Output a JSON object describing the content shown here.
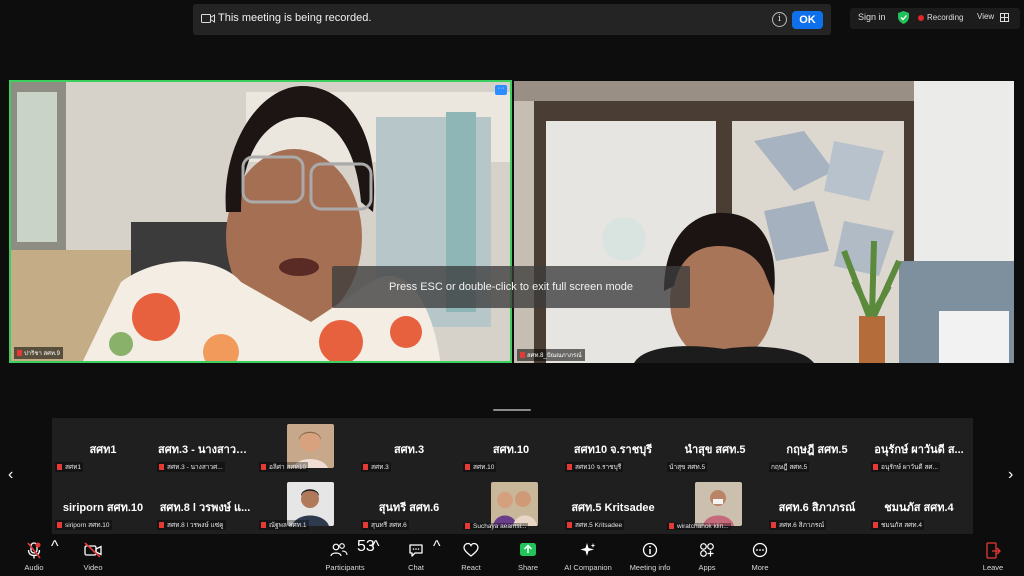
{
  "banner": {
    "message": "This meeting is being recorded.",
    "ok_label": "OK",
    "info_glyph": "i"
  },
  "top_right": {
    "sign_in": "Sign in",
    "recording": "Recording",
    "view": "View"
  },
  "videos": {
    "left_name": "ปาริชา สศท.9",
    "right_name": "สศท.8_ปัณณภาภรณ์",
    "more_glyph": "···"
  },
  "overlay": {
    "message": "Press ESC or double-click to exit full screen mode"
  },
  "gallery": {
    "prev_glyph": "‹",
    "next_glyph": "›",
    "row1": [
      {
        "big": "สศท1",
        "small": "สศท1"
      },
      {
        "big": "สศท.3 - นางสาวศ...",
        "small": "สศท.3 - นางสาวศ..."
      },
      {
        "big": "",
        "small": "อลิศา สศท10"
      },
      {
        "big": "สศท.3",
        "small": "สศท.3"
      },
      {
        "big": "สศท.10",
        "small": "สศท.10"
      },
      {
        "big": "สศท10 จ.ราชบุรี",
        "small": "สศท10 จ.ราชบุรี"
      },
      {
        "big": "นำสุข สศท.5",
        "small": "นำสุข สศท.5"
      },
      {
        "big": "กฤษฎี สศท.5",
        "small": "กฤษฎี สศท.5"
      },
      {
        "big": "อนุรักษ์ ผาวันดี ส...",
        "small": "อนุรักษ์ ผาวันดี สศ..."
      }
    ],
    "row2": [
      {
        "big": "siriporn สศท.10",
        "small": "siriporn สศท.10"
      },
      {
        "big": "สศท.8 l วรพงษ์ แ...",
        "small": "สศท.8 l วรพงษ์ แซ่คู"
      },
      {
        "big": "",
        "small": "ณัฐพล สศท.1"
      },
      {
        "big": "สุนทรี สศท.6",
        "small": "สุนทรี สศท.6"
      },
      {
        "big": "",
        "small": "Suchaya aeamsi..."
      },
      {
        "big": "สศท.5 Kritsadee",
        "small": "สศท.5 Kritsadee"
      },
      {
        "big": "",
        "small": "wiratchanok klin..."
      },
      {
        "big": "สศท.6 สิภาภรณ์",
        "small": "สศท.6 สิภาภรณ์"
      },
      {
        "big": "ชมนภัส สศท.4",
        "small": "ชมนภัส สศท.4"
      }
    ]
  },
  "toolbar": {
    "audio": "Audio",
    "video": "Video",
    "participants": "Participants",
    "participant_count": "53",
    "chat": "Chat",
    "react": "React",
    "share": "Share",
    "ai": "AI Companion",
    "info": "Meeting info",
    "apps": "Apps",
    "more": "More",
    "leave": "Leave",
    "caret": "^"
  },
  "colors": {
    "accent": "#0e71eb",
    "active_border": "#3ccf5e",
    "mute_red": "#e53935",
    "share_green": "#23c35b"
  }
}
